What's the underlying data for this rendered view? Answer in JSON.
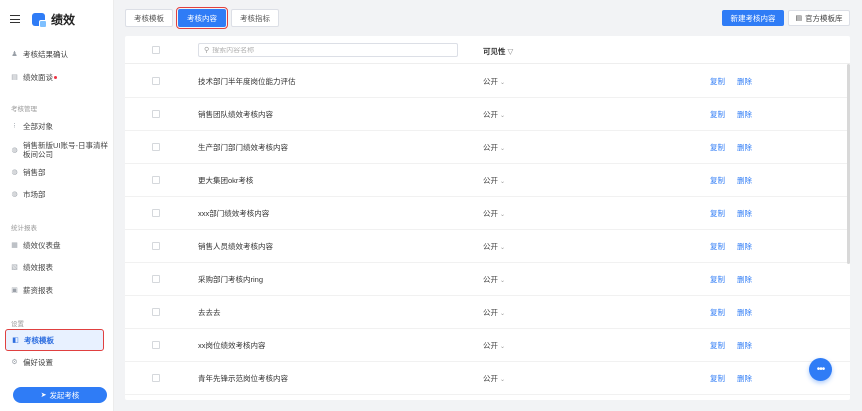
{
  "app": {
    "title": "绩效"
  },
  "sidebar": {
    "top_items": [
      {
        "label": "考核结果确认",
        "icon": "person-icon"
      },
      {
        "label": "绩效面谈",
        "icon": "chat-icon",
        "has_dot": true
      }
    ],
    "group_manage": "考核管理",
    "manage_items": [
      {
        "label": "全部对象",
        "icon": "grid-icon"
      },
      {
        "label": "销售新版UI账号-日事清样板间公司",
        "icon": "building-icon"
      },
      {
        "label": "销售部",
        "icon": "building-icon"
      },
      {
        "label": "市场部",
        "icon": "building-icon"
      }
    ],
    "group_report": "统计报表",
    "report_items": [
      {
        "label": "绩效仪表盘",
        "icon": "dashboard-icon"
      },
      {
        "label": "绩效报表",
        "icon": "report-icon"
      },
      {
        "label": "薪资报表",
        "icon": "wallet-icon"
      }
    ],
    "group_settings": "设置",
    "settings_items": [
      {
        "label": "考核模板",
        "icon": "template-icon",
        "active": true
      },
      {
        "label": "偏好设置",
        "icon": "gear-icon"
      }
    ],
    "launch_button": "发起考核"
  },
  "tabs": [
    {
      "label": "考核模板"
    },
    {
      "label": "考核内容",
      "active": true
    },
    {
      "label": "考核指标"
    }
  ],
  "toolbar": {
    "new_button": "新建考核内容",
    "library_button": "官方模板库"
  },
  "table": {
    "search_placeholder": "搜索内容名称",
    "column_visibility": "可见性",
    "rows": [
      {
        "name": "技术部门半年度岗位能力评估",
        "visibility": "公开",
        "copy": "复制",
        "delete": "删除"
      },
      {
        "name": "销售团队绩效考核内容",
        "visibility": "公开",
        "copy": "复制",
        "delete": "删除"
      },
      {
        "name": "生产部门部门绩效考核内容",
        "visibility": "公开",
        "copy": "复制",
        "delete": "删除"
      },
      {
        "name": "更大集团okr考核",
        "visibility": "公开",
        "copy": "复制",
        "delete": "删除"
      },
      {
        "name": "xxx部门绩效考核内容",
        "visibility": "公开",
        "copy": "复制",
        "delete": "删除"
      },
      {
        "name": "销售人员绩效考核内容",
        "visibility": "公开",
        "copy": "复制",
        "delete": "删除"
      },
      {
        "name": "采购部门考核内ring",
        "visibility": "公开",
        "copy": "复制",
        "delete": "删除"
      },
      {
        "name": "去去去",
        "visibility": "公开",
        "copy": "复制",
        "delete": "删除"
      },
      {
        "name": "xx岗位绩效考核内容",
        "visibility": "公开",
        "copy": "复制",
        "delete": "删除"
      },
      {
        "name": "青年先锋示范岗位考核内容",
        "visibility": "公开",
        "copy": "复制",
        "delete": "删除"
      }
    ]
  },
  "colors": {
    "primary": "#2f7cf6",
    "highlight": "#e04040",
    "active_bg": "#e8f1ff"
  }
}
